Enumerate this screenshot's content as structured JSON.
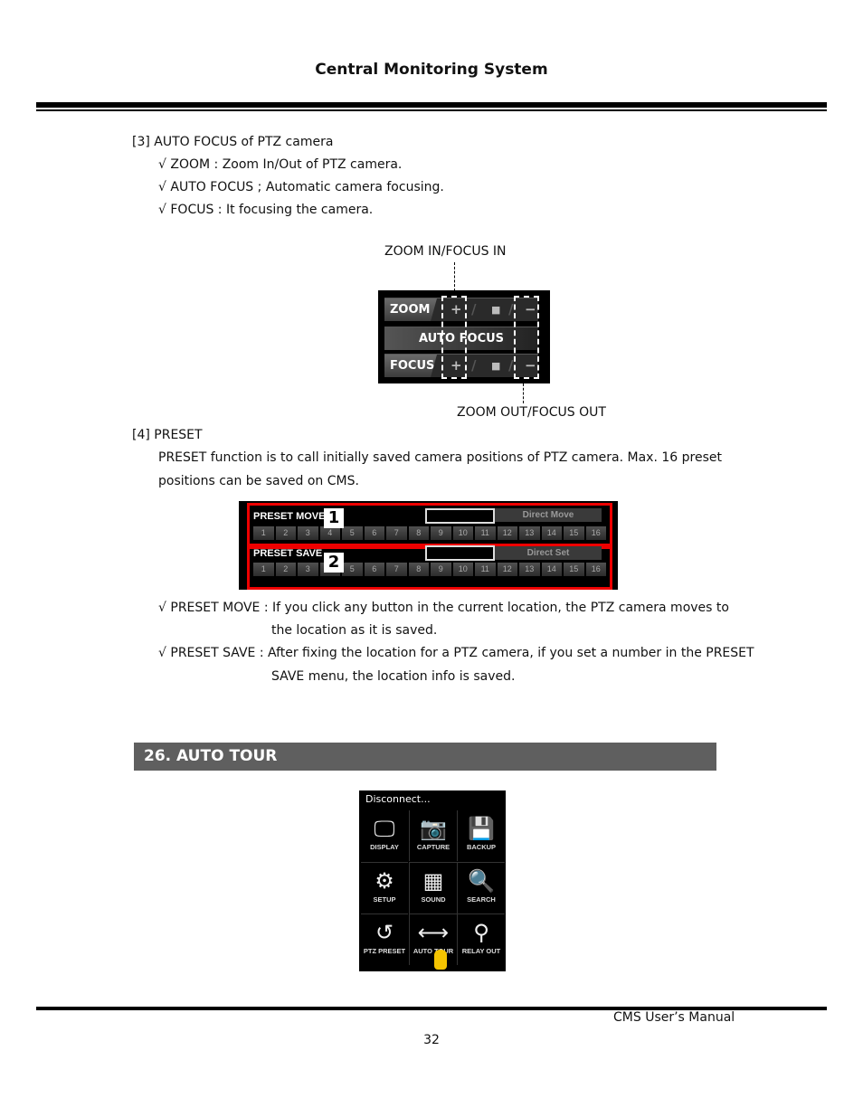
{
  "header": {
    "title": "Central Monitoring System"
  },
  "section3": {
    "heading": "[3] AUTO FOCUS of PTZ camera",
    "bullets": [
      "√ ZOOM : Zoom In/Out of PTZ camera.",
      "√ AUTO FOCUS ; Automatic camera focusing.",
      "√ FOCUS : It focusing the camera."
    ]
  },
  "focus_figure": {
    "label_top": "ZOOM IN/FOCUS IN",
    "label_bottom": "ZOOM OUT/FOCUS OUT",
    "zoom": "ZOOM",
    "auto_focus": "AUTO FOCUS",
    "focus": "FOCUS",
    "plus": "+",
    "stop": "■",
    "minus": "−",
    "sep": "/"
  },
  "section4": {
    "heading": "[4] PRESET",
    "para1": "PRESET function is to call initially saved camera positions of PTZ camera. Max. 16 preset",
    "para2": "positions can be saved on CMS.",
    "bullet1a": "√ PRESET MOVE : If you click any button in the current location, the PTZ camera moves to",
    "bullet1b": "the   location as it is saved.",
    "bullet2a": "√ PRESET SAVE : After fixing the location for a PTZ camera, if you set a number in the PRESET",
    "bullet2b": "SAVE menu, the location info is saved."
  },
  "preset_figure": {
    "move_label": "PRESET MOVE",
    "save_label": "PRESET SAVE",
    "direct_move": "Direct Move",
    "direct_set": "Direct Set",
    "callout1": "1",
    "callout2": "2",
    "buttons": [
      "1",
      "2",
      "3",
      "4",
      "5",
      "6",
      "7",
      "8",
      "9",
      "10",
      "11",
      "12",
      "13",
      "14",
      "15",
      "16"
    ]
  },
  "section26": {
    "title": "26. AUTO TOUR"
  },
  "menu_figure": {
    "status": "Disconnect...",
    "items": [
      {
        "label": "DISPLAY",
        "icon": "monitor-icon",
        "glyph": "🖵"
      },
      {
        "label": "CAPTURE",
        "icon": "camera-icon",
        "glyph": "📷"
      },
      {
        "label": "BACKUP",
        "icon": "floppy-icon",
        "glyph": "💾"
      },
      {
        "label": "SETUP",
        "icon": "gear-icon",
        "glyph": "⚙"
      },
      {
        "label": "SOUND",
        "icon": "equalizer-icon",
        "glyph": "▦"
      },
      {
        "label": "SEARCH",
        "icon": "magnifier-icon",
        "glyph": "🔍"
      },
      {
        "label": "PTZ PRESET",
        "icon": "rotate-icon",
        "glyph": "↺"
      },
      {
        "label": "AUTO TOUR",
        "icon": "arrows-horizontal-icon",
        "glyph": "⟷"
      },
      {
        "label": "RELAY OUT",
        "icon": "relay-switch-icon",
        "glyph": "⚲"
      }
    ]
  },
  "footer": {
    "manual": "CMS User’s Manual",
    "page": "32"
  }
}
